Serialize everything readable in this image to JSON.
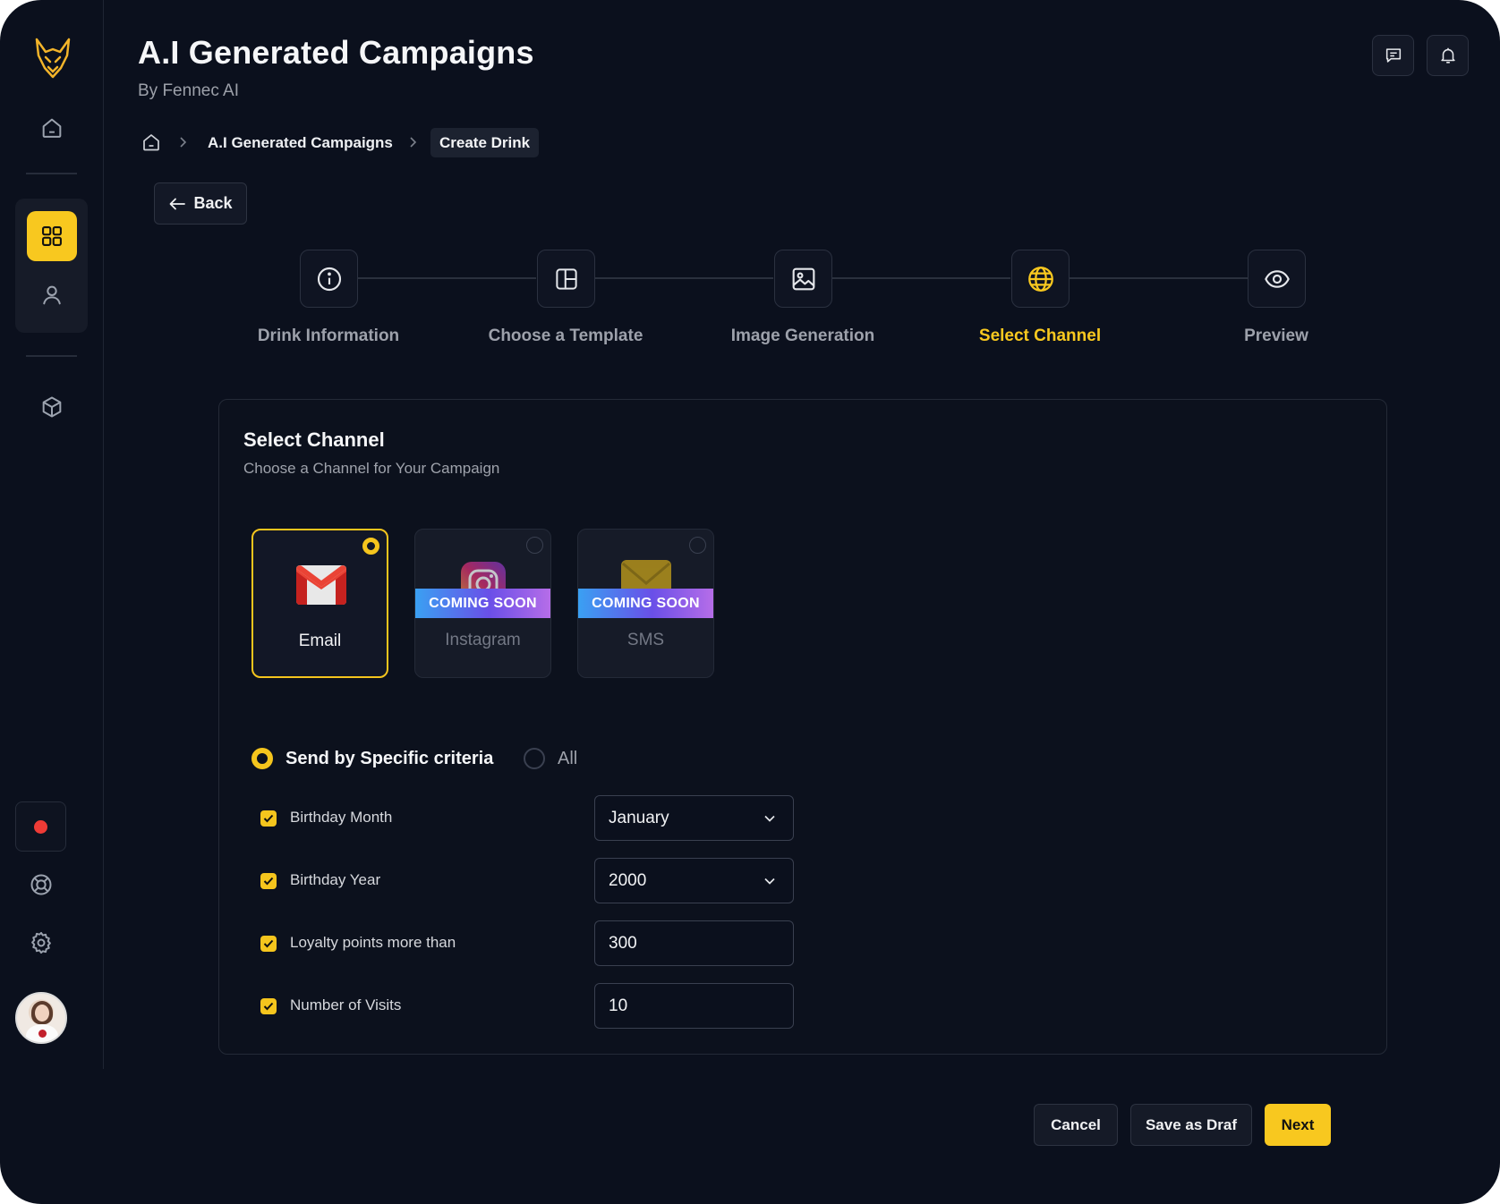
{
  "header": {
    "title": "A.I Generated Campaigns",
    "subtitle": "By Fennec AI"
  },
  "topbar": {
    "icons": [
      "message-icon",
      "bell-icon"
    ]
  },
  "sidebar": {
    "logo": "fennec-logo",
    "items": [
      "home-icon",
      "grid-icon",
      "user-icon",
      "cube-icon"
    ],
    "active": "grid-icon",
    "bottom": [
      "record-icon",
      "lifebuoy-icon",
      "gear-icon",
      "avatar"
    ],
    "accent": "#f8c81f"
  },
  "breadcrumb": {
    "items": [
      "A.I Generated Campaigns",
      "Create Drink"
    ]
  },
  "back_label": "Back",
  "stepper": {
    "steps": [
      {
        "label": "Drink Information",
        "icon": "info-icon"
      },
      {
        "label": "Choose a Template",
        "icon": "template-icon"
      },
      {
        "label": "Image Generation",
        "icon": "image-icon"
      },
      {
        "label": "Select Channel",
        "icon": "globe-icon"
      },
      {
        "label": "Preview",
        "icon": "eye-icon"
      }
    ],
    "active_index": 3
  },
  "card": {
    "title": "Select Channel",
    "subtitle": "Choose a Channel for Your Campaign"
  },
  "channels": [
    {
      "label": "Email",
      "icon": "gmail-icon",
      "selected": true
    },
    {
      "label": "Instagram",
      "icon": "instagram-icon",
      "badge": "COMING SOON"
    },
    {
      "label": "SMS",
      "icon": "sms-icon",
      "badge": "COMING SOON"
    }
  ],
  "send_mode": {
    "options": [
      "Send by Specific criteria",
      "All"
    ],
    "selected": "Send by Specific criteria"
  },
  "criteria": [
    {
      "label": "Birthday Month",
      "value": "January",
      "type": "select",
      "checked": true
    },
    {
      "label": "Birthday Year",
      "value": "2000",
      "type": "select",
      "checked": true
    },
    {
      "label": "Loyalty points more than",
      "value": "300",
      "type": "input",
      "checked": true
    },
    {
      "label": "Number of Visits",
      "value": "10",
      "type": "input",
      "checked": true
    }
  ],
  "footer": {
    "cancel": "Cancel",
    "save_draft": "Save as Draf",
    "next": "Next"
  }
}
